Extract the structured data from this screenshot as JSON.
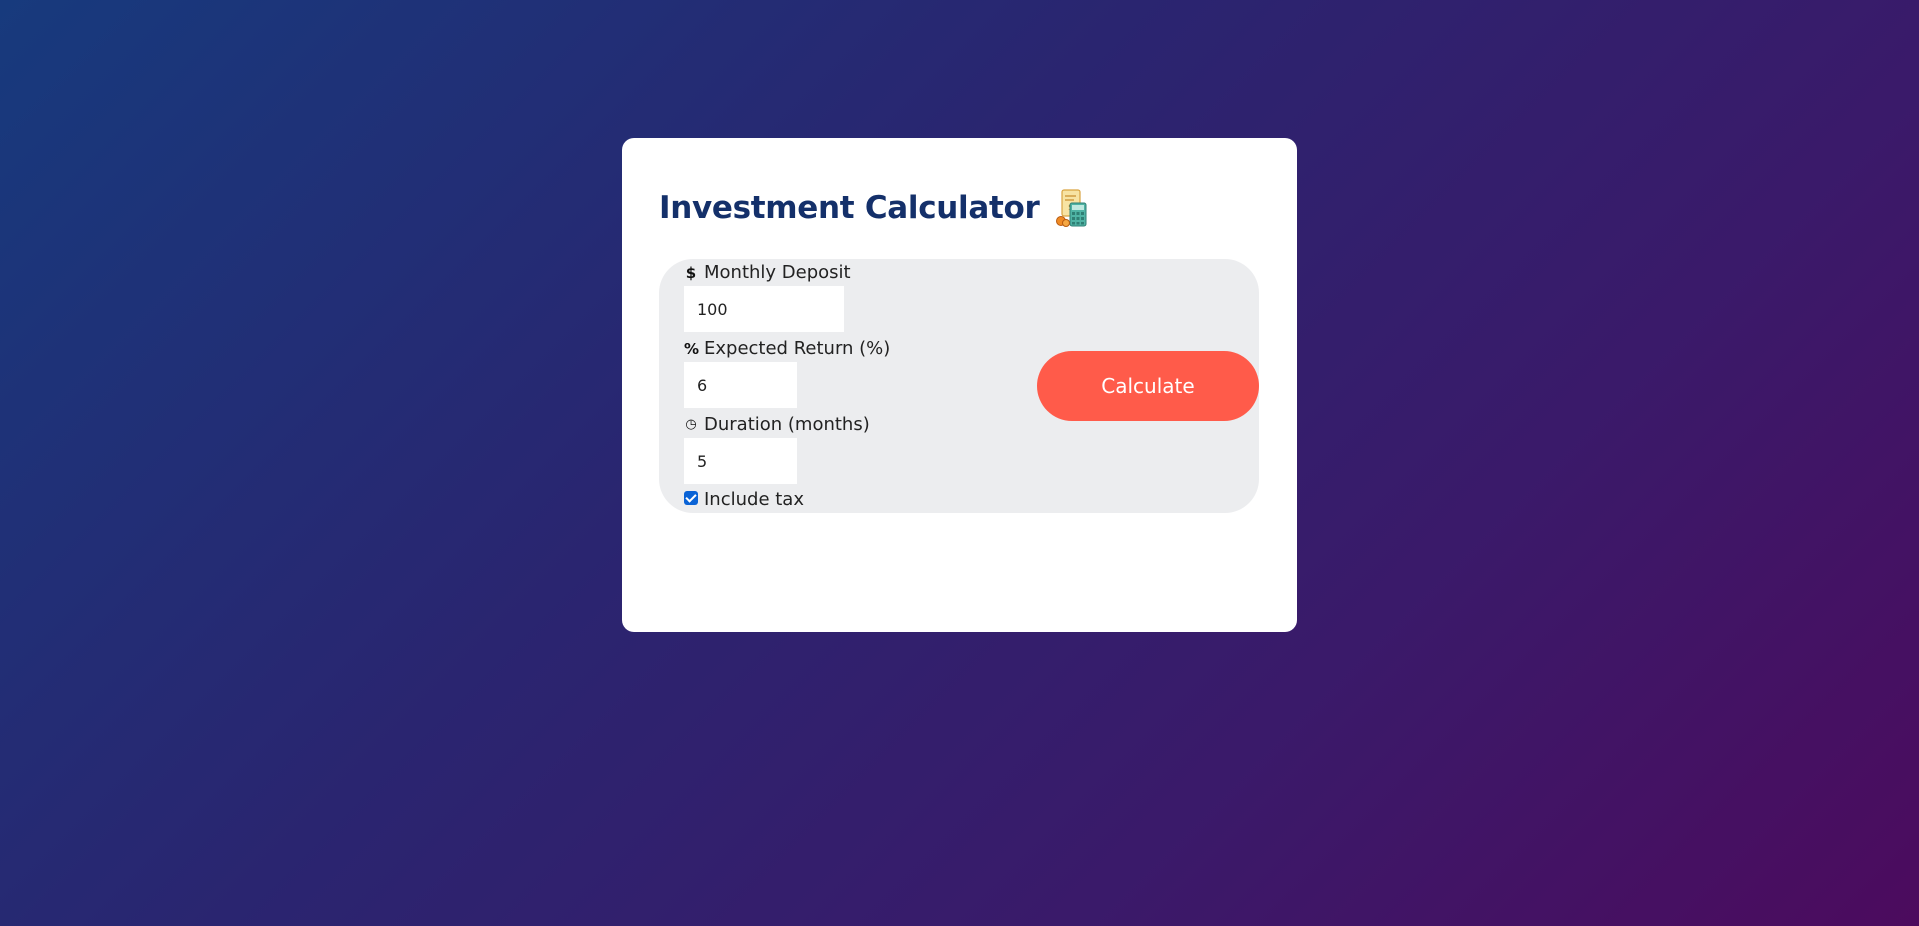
{
  "header": {
    "title": "Investment Calculator",
    "title_icon": "calculator-receipt-icon"
  },
  "form": {
    "monthly_deposit": {
      "label": "Monthly Deposit",
      "icon": "dollar-icon",
      "icon_glyph": "$",
      "value": "100"
    },
    "expected_return": {
      "label": "Expected Return (%)",
      "icon": "percent-icon",
      "icon_glyph": "%",
      "value": "6"
    },
    "duration": {
      "label": "Duration (months)",
      "icon": "clock-icon",
      "icon_glyph": "◷",
      "value": "5"
    },
    "include_tax": {
      "label": "Include tax",
      "checked": true
    }
  },
  "actions": {
    "calculate_label": "Calculate"
  },
  "colors": {
    "accent": "#ff5b4a",
    "title": "#14306a",
    "checkbox": "#0a63d6"
  }
}
